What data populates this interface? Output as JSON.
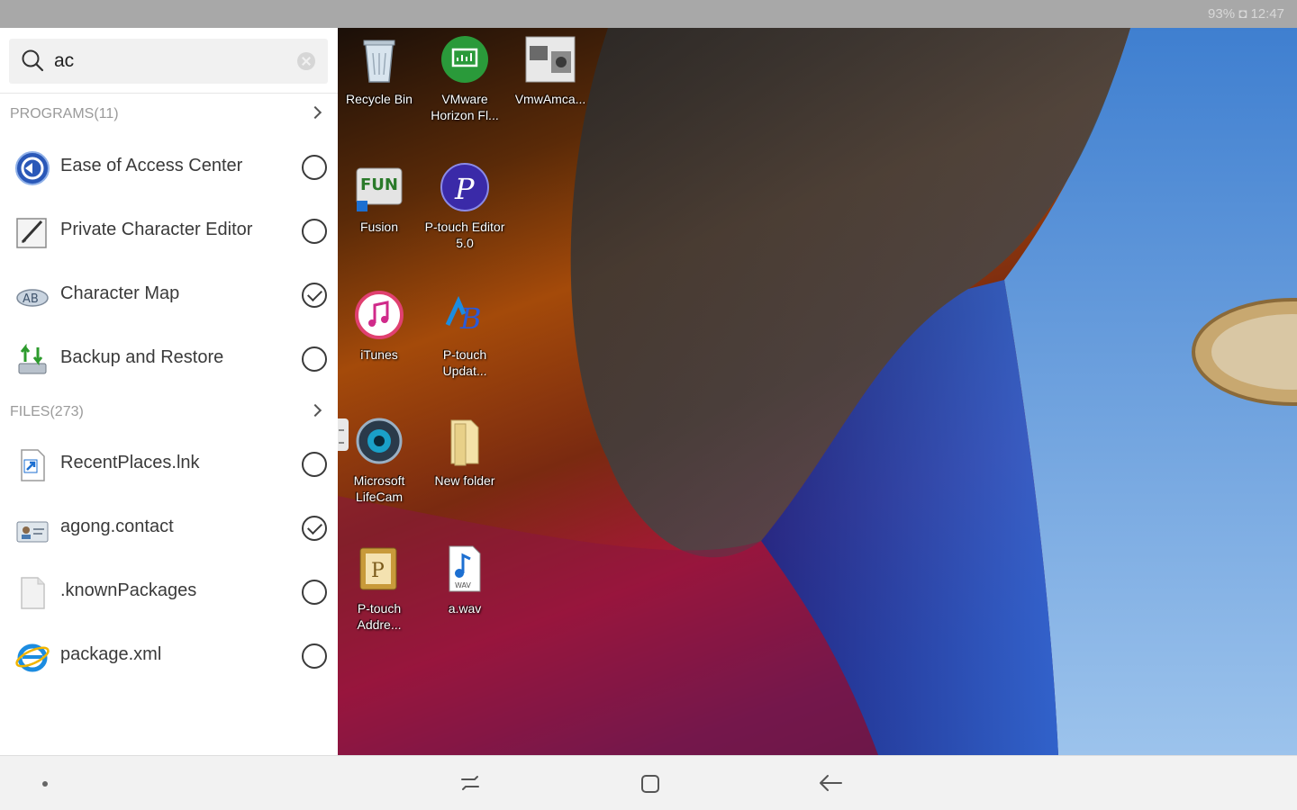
{
  "status": {
    "text": "93% ◘ 12:47"
  },
  "search": {
    "value": "ac",
    "placeholder": ""
  },
  "programs": {
    "header": "PROGRAMS(11)",
    "items": [
      {
        "label": "Ease of Access Center",
        "checked": false,
        "icon": "ease-of-access-icon"
      },
      {
        "label": "Private Character Editor",
        "checked": false,
        "icon": "character-editor-icon"
      },
      {
        "label": "Character Map",
        "checked": true,
        "icon": "character-map-icon"
      },
      {
        "label": "Backup and Restore",
        "checked": false,
        "icon": "backup-restore-icon"
      }
    ]
  },
  "files": {
    "header": "FILES(273)",
    "items": [
      {
        "label": "RecentPlaces.lnk",
        "checked": false,
        "icon": "shortcut-file-icon"
      },
      {
        "label": "agong.contact",
        "checked": true,
        "icon": "contact-file-icon"
      },
      {
        "label": ".knownPackages",
        "checked": false,
        "icon": "generic-file-icon"
      },
      {
        "label": "package.xml",
        "checked": false,
        "icon": "internet-explorer-icon"
      }
    ]
  },
  "desktop": {
    "icons": [
      {
        "label": "Recycle Bin",
        "icon": "recycle-bin-icon"
      },
      {
        "label": "VMware Horizon Fl...",
        "icon": "vmware-horizon-icon"
      },
      {
        "label": "VmwAmca...",
        "icon": "vmware-amca-icon"
      },
      {
        "label": "Fusion",
        "icon": "fun-station-icon"
      },
      {
        "label": "P-touch Editor 5.0",
        "icon": "ptouch-editor-icon"
      },
      {
        "label": "iTunes",
        "icon": "itunes-icon"
      },
      {
        "label": "P-touch Updat...",
        "icon": "ptouch-update-icon"
      },
      {
        "label": "Microsoft LifeCam",
        "icon": "lifecam-icon"
      },
      {
        "label": "New folder",
        "icon": "folder-icon"
      },
      {
        "label": "P-touch Addre...",
        "icon": "ptouch-address-icon"
      },
      {
        "label": "a.wav",
        "icon": "wav-file-icon"
      }
    ]
  },
  "colors": {
    "panel_bg": "#ffffff",
    "status_bar": "#a8a8a8",
    "nav_bar": "#f2f2f2",
    "accent_blue": "#1c6fd1"
  }
}
